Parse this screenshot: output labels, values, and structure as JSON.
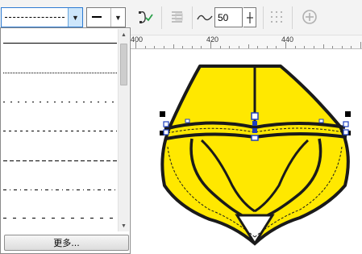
{
  "toolbar": {
    "line_style_combo": {
      "selected": "dashed",
      "arrow_icon": "chevron-down-icon"
    },
    "arrowhead_combo": {
      "selected": "none",
      "arrow_icon": "chevron-down-icon"
    },
    "icons": [
      "node-check-icon",
      "text-wrap-icon",
      "smoothing-curve-icon",
      "plus-minus-spin-icon",
      "dotted-grid-icon",
      "add-circle-icon"
    ],
    "smoothing_value": "50"
  },
  "ruler": {
    "labels": [
      "400",
      "420",
      "440"
    ]
  },
  "line_style_dropdown": {
    "items": [
      {
        "style": "solid"
      },
      {
        "style": "fine-dotted"
      },
      {
        "style": "short-dashed"
      },
      {
        "style": "dashed"
      },
      {
        "style": "long-dashed"
      },
      {
        "style": "dash-dot"
      },
      {
        "style": "long-dash-gap"
      }
    ],
    "more_button": "更多..."
  },
  "colors": {
    "shape_fill": "#ffe800",
    "shape_outline": "#1a1a1a",
    "selection_handle": "#000000",
    "node_handle": "#1f3fbf",
    "accent": "#2d7bd2"
  }
}
